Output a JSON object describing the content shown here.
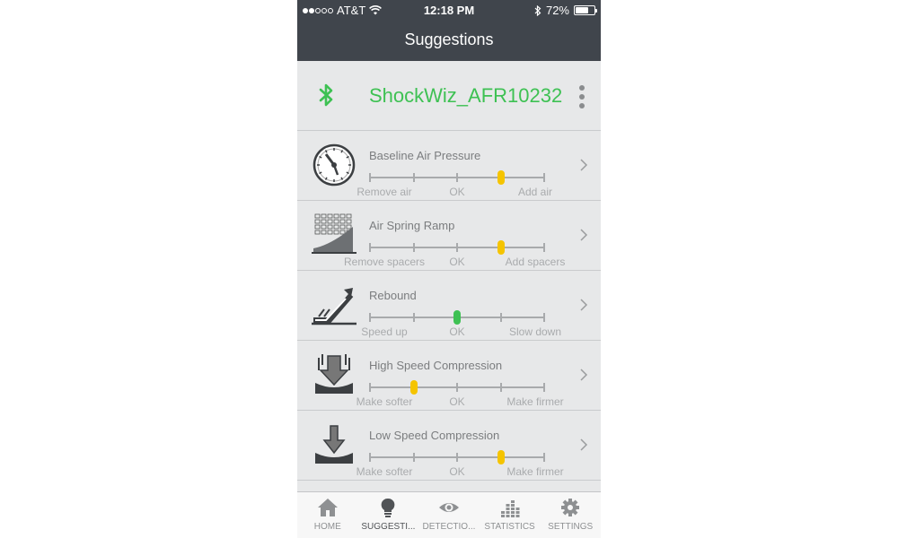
{
  "status": {
    "carrier": "AT&T",
    "time": "12:18 PM",
    "battery": "72%",
    "battery_level": 0.72
  },
  "header": {
    "title": "Suggestions"
  },
  "device": {
    "name": "ShockWiz_AFR10232",
    "icon": "bluetooth-icon",
    "color": "#3ec153"
  },
  "suggestions": [
    {
      "title": "Baseline Air Pressure",
      "icon": "gauge-icon",
      "labels": [
        "Remove air",
        "OK",
        "Add air"
      ],
      "position": 3,
      "knob_color": "#f5c400"
    },
    {
      "title": "Air Spring Ramp",
      "icon": "spring-ramp-icon",
      "labels": [
        "Remove spacers",
        "OK",
        "Add spacers"
      ],
      "position": 3,
      "knob_color": "#f5c400"
    },
    {
      "title": "Rebound",
      "icon": "rebound-icon",
      "labels": [
        "Speed up",
        "OK",
        "Slow down"
      ],
      "position": 2,
      "knob_color": "#3ec153"
    },
    {
      "title": "High Speed Compression",
      "icon": "high-speed-compression-icon",
      "labels": [
        "Make softer",
        "OK",
        "Make firmer"
      ],
      "position": 1,
      "knob_color": "#f5c400"
    },
    {
      "title": "Low Speed Compression",
      "icon": "low-speed-compression-icon",
      "labels": [
        "Make softer",
        "OK",
        "Make firmer"
      ],
      "position": 3,
      "knob_color": "#f5c400"
    }
  ],
  "tabs": [
    {
      "label": "HOME",
      "icon": "home-icon",
      "active": false
    },
    {
      "label": "SUGGESTI...",
      "icon": "lightbulb-icon",
      "active": true
    },
    {
      "label": "DETECTIO...",
      "icon": "eye-icon",
      "active": false
    },
    {
      "label": "STATISTICS",
      "icon": "statistics-icon",
      "active": false
    },
    {
      "label": "SETTINGS",
      "icon": "gear-icon",
      "active": false
    }
  ]
}
